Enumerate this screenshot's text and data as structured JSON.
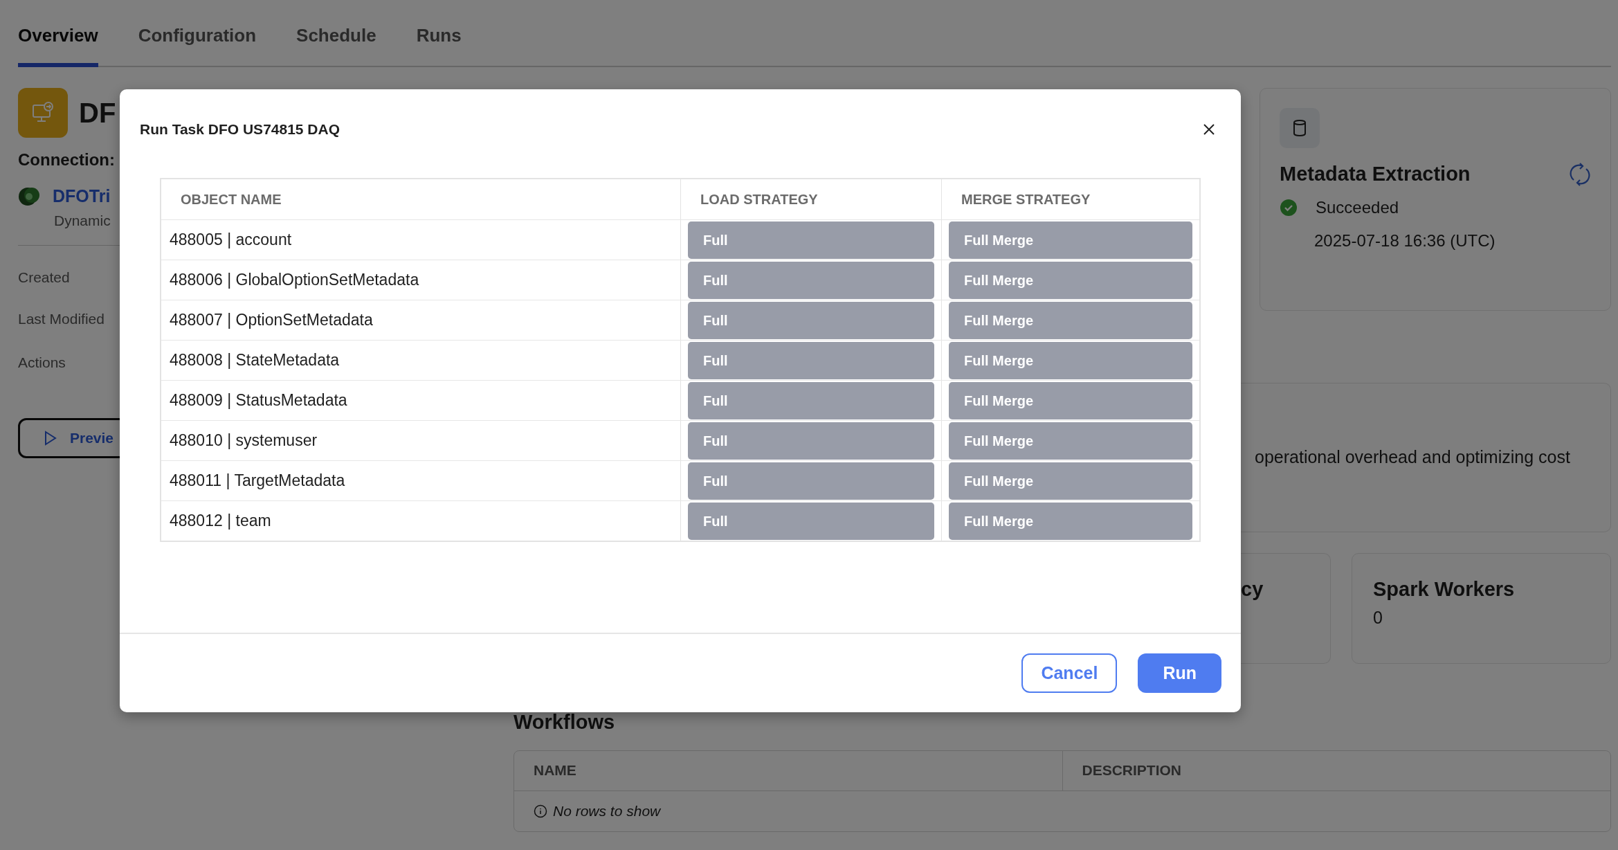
{
  "tabs": [
    {
      "label": "Overview",
      "selected": true
    },
    {
      "label": "Configuration",
      "selected": false
    },
    {
      "label": "Schedule",
      "selected": false
    },
    {
      "label": "Runs",
      "selected": false
    }
  ],
  "task": {
    "title": "DF",
    "connection_label": "Connection:",
    "connection_name": "DFOTri",
    "connection_type": "Dynamic",
    "fields": [
      "Created",
      "Last Modified",
      "Actions"
    ],
    "preview_button": "Previe"
  },
  "metadata_card": {
    "title": "Metadata Extraction",
    "status": "Succeeded",
    "timestamp": "2025-07-18 16:36 (UTC)"
  },
  "description_card": {
    "text": "operational overhead and optimizing cost"
  },
  "stat_cards": [
    {
      "title": "cy"
    },
    {
      "title": "Spark Workers",
      "value": "0"
    }
  ],
  "workflows": {
    "heading": "Workflows",
    "columns": [
      "NAME",
      "DESCRIPTION"
    ],
    "empty_message": "No rows to show"
  },
  "modal": {
    "title": "Run Task DFO US74815 DAQ",
    "columns": [
      "OBJECT NAME",
      "LOAD STRATEGY",
      "MERGE STRATEGY"
    ],
    "rows": [
      {
        "object": "488005 | account",
        "load": "Full",
        "merge": "Full Merge"
      },
      {
        "object": "488006 | GlobalOptionSetMetadata",
        "load": "Full",
        "merge": "Full Merge"
      },
      {
        "object": "488007 | OptionSetMetadata",
        "load": "Full",
        "merge": "Full Merge"
      },
      {
        "object": "488008 | StateMetadata",
        "load": "Full",
        "merge": "Full Merge"
      },
      {
        "object": "488009 | StatusMetadata",
        "load": "Full",
        "merge": "Full Merge"
      },
      {
        "object": "488010 | systemuser",
        "load": "Full",
        "merge": "Full Merge"
      },
      {
        "object": "488011 | TargetMetadata",
        "load": "Full",
        "merge": "Full Merge"
      },
      {
        "object": "488012 | team",
        "load": "Full",
        "merge": "Full Merge"
      }
    ],
    "buttons": [
      {
        "label": "Cancel",
        "kind": "secondary"
      },
      {
        "label": "Run",
        "kind": "primary"
      }
    ]
  }
}
